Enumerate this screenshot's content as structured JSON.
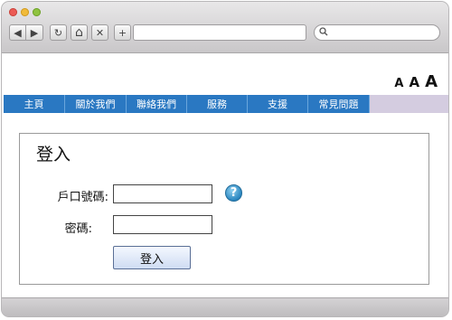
{
  "toolbar": {
    "back_icon": "◀",
    "forward_icon": "▶",
    "reload_icon": "↻",
    "home_icon": "⌂",
    "stop_icon": "✕",
    "add_icon": "+",
    "url_value": "",
    "search_value": "",
    "search_icon": "⚲"
  },
  "font_size_controls": {
    "small": "A",
    "medium": "A",
    "large": "A"
  },
  "menu": {
    "items": [
      {
        "label": "主頁"
      },
      {
        "label": "關於我們"
      },
      {
        "label": "聯絡我們"
      },
      {
        "label": "服務"
      },
      {
        "label": "支援"
      },
      {
        "label": "常見問題"
      }
    ]
  },
  "login": {
    "title": "登入",
    "account_label": "戶口號碼:",
    "account_value": "",
    "password_label": "密碼:",
    "password_value": "",
    "help_icon": "?",
    "submit_label": "登入"
  }
}
